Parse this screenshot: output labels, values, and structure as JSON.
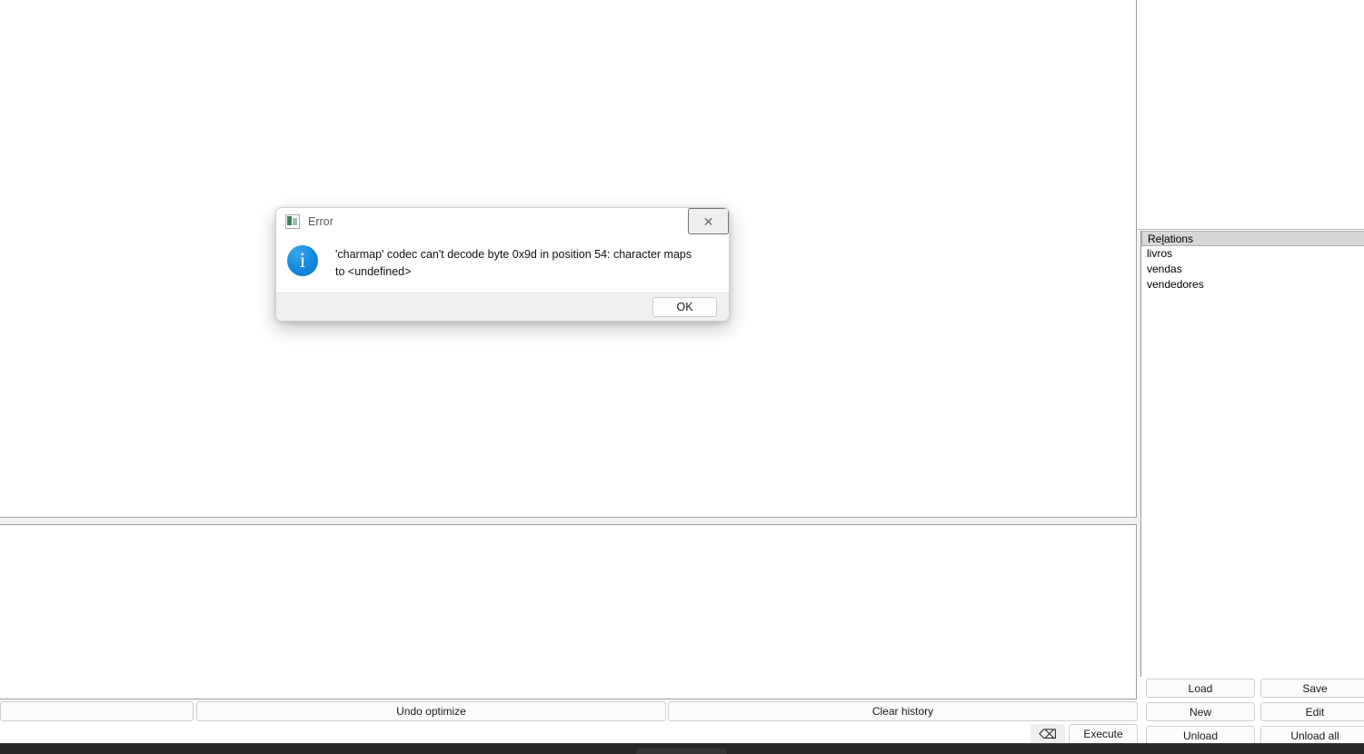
{
  "workspace": {
    "top_pane_content": "",
    "history_pane_content": ""
  },
  "toolbar": {
    "blank_label": "",
    "undo_optimize_label": "Undo optimize",
    "clear_history_label": "Clear history"
  },
  "command_bar": {
    "input_value": "",
    "input_placeholder": "",
    "erase_icon": "backspace-erase-icon",
    "erase_glyph": "⌫",
    "execute_label": "Execute"
  },
  "relations_panel": {
    "header_prefix": "Re",
    "header_mnemonic": "l",
    "header_suffix": "ations",
    "header_label": "Relations",
    "items": [
      {
        "label": "livros"
      },
      {
        "label": "vendas"
      },
      {
        "label": "vendedores"
      }
    ],
    "buttons": {
      "load": "Load",
      "save": "Save",
      "new": "New",
      "edit": "Edit",
      "unload": "Unload",
      "unload_all": "Unload all"
    }
  },
  "error_dialog": {
    "app_icon": "app-window-icon",
    "title": "Error",
    "close_glyph": "✕",
    "severity_icon": "info-circle-icon",
    "message": "'charmap' codec can't decode byte 0x9d in position 54: character maps to <undefined>",
    "ok_label": "OK"
  },
  "taskbar": {
    "label": ""
  },
  "colors": {
    "dialog_accent": "#1287dd",
    "panel_bg": "#f0f0f0",
    "header_bg": "#d7d7d7",
    "border": "#9a9a9a",
    "taskbar_bg": "#262626"
  }
}
